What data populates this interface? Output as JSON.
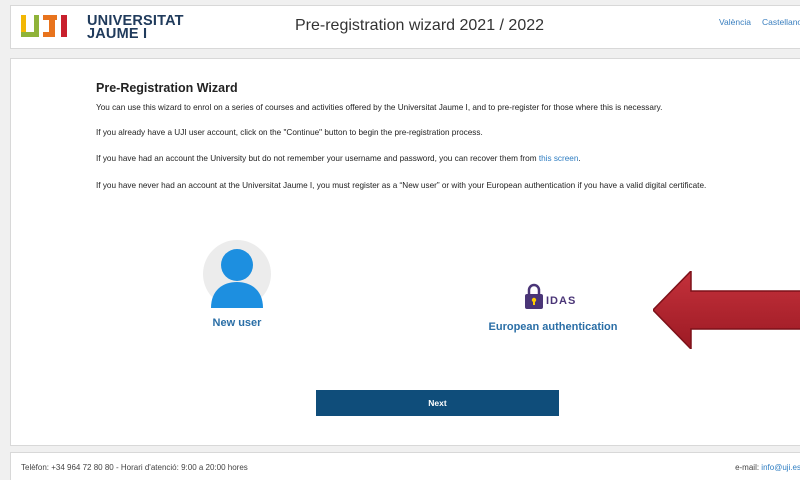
{
  "header": {
    "logo_line1": "UNIVERSITAT",
    "logo_line2": "JAUME I",
    "title": "Pre-registration wizard 2021 / 2022",
    "languages": [
      "València",
      "Castellano"
    ]
  },
  "main": {
    "heading": "Pre-Registration Wizard",
    "para1": "You can use this wizard to enrol on a series of courses and activities offered by the Universitat Jaume I, and to pre-register for those where this is necessary.",
    "para2": "If you already have a UJI user account, click on the \"Continue\" button to begin the pre-registration process.",
    "para3_text": "If you have had an account the University but do not remember your username and password, you can recover them from ",
    "para3_link": "this screen",
    "para3_end": ".",
    "para4": "If you have never had an account at the Universitat Jaume I, you must register as a “New user” or with your European authentication if you have a valid digital certificate.",
    "options": {
      "new_user": "New user",
      "european_auth": "European authentication",
      "eidas_logo_text": "IDAS"
    },
    "next_label": "Next"
  },
  "footer": {
    "left": "Telèfon: +34 964 72 80 80 - Horari d'atenció: 9:00 a 20:00 hores",
    "email_label": "e-mail: ",
    "email": "info@uji.es"
  },
  "colors": {
    "accent": "#0f4d7a",
    "link": "#2e7dc2",
    "arrow": "#b5222d",
    "logo_yellow": "#f2b705",
    "logo_green": "#8fb339",
    "logo_orange": "#e8731d",
    "logo_red": "#c8202d"
  }
}
